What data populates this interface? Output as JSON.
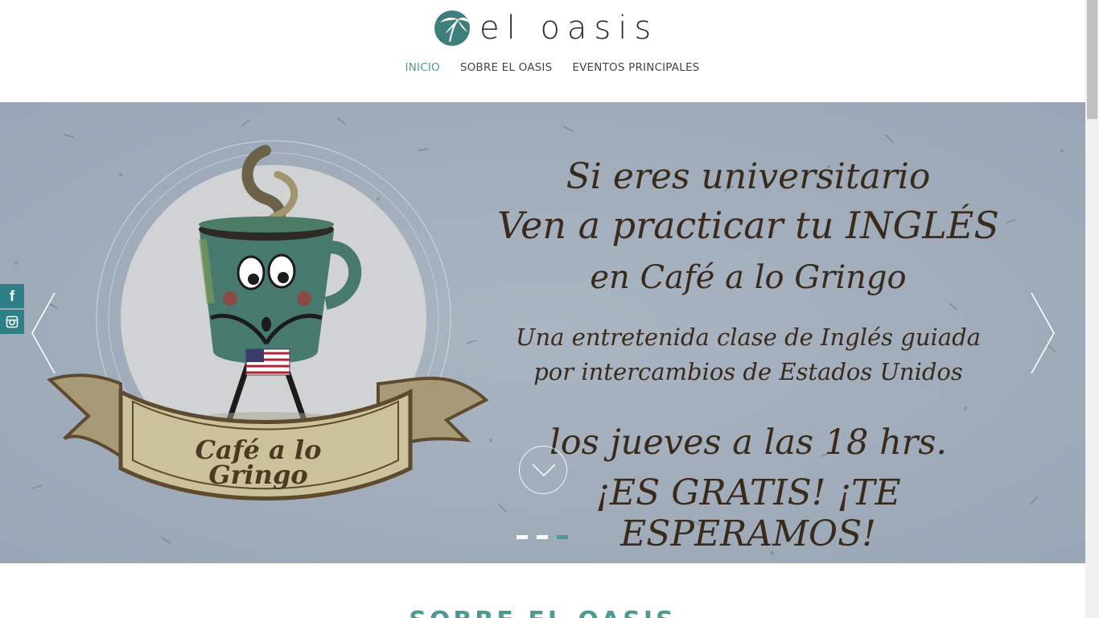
{
  "brand": {
    "name": "el oasis"
  },
  "nav": [
    {
      "label": "INICIO",
      "active": true
    },
    {
      "label": "SOBRE EL OASIS",
      "active": false
    },
    {
      "label": "EVENTOS PRINCIPALES",
      "active": false
    }
  ],
  "slide": {
    "line1": "Si eres universitario",
    "line2": "Ven a practicar tu INGLÉS",
    "line3": "en Café a lo Gringo",
    "line4": "Una entretenida clase de Inglés guiada",
    "line5": "por intercambios de Estados Unidos",
    "line6": "los jueves a las 18 hrs.",
    "line7": "¡ES GRATIS! ¡TE ESPERAMOS!",
    "banner_line1": "Café a lo",
    "banner_line2": "Gringo",
    "dots_count": 3,
    "active_dot": 3
  },
  "social": {
    "facebook": "f",
    "instagram_icon": "instagram-icon"
  },
  "section": {
    "title": "SOBRE EL OASIS"
  },
  "colors": {
    "accent": "#4c9a91",
    "social": "#2f7f86",
    "hero_bg": "#a3afbd",
    "text_brown": "#3a2a1c"
  }
}
